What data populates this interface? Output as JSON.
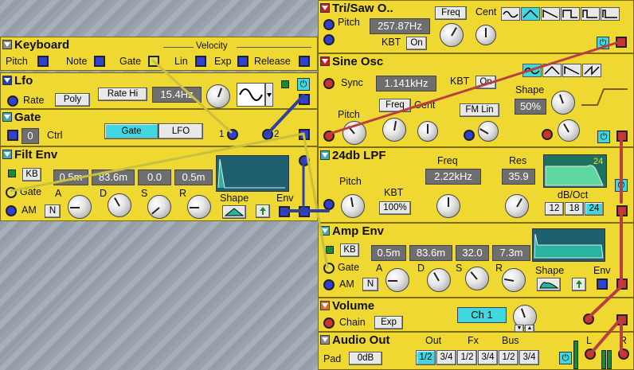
{
  "tri_saw": {
    "title": "Tri/Saw O..",
    "pitch_label": "Pitch",
    "freq_value": "257.87Hz",
    "freq_btn": "Freq",
    "cent_label": "Cent",
    "kbt_label": "KBT",
    "kbt_value": "On"
  },
  "keyboard": {
    "title": "Keyboard",
    "velocity_label": "Velocity",
    "pitch": "Pitch",
    "note": "Note",
    "gate": "Gate",
    "lin": "Lin",
    "exp": "Exp",
    "release": "Release"
  },
  "sine_osc": {
    "title": "Sine Osc",
    "sync_label": "Sync",
    "freq_value": "1.141kHz",
    "kbt_label": "KBT",
    "kbt_value": "On",
    "shape_label": "Shape",
    "shape_value": "50%",
    "pitch_label": "Pitch",
    "freq_btn": "Freq",
    "cent_label": "Cent",
    "fm_btn": "FM Lin"
  },
  "lfo": {
    "title": "Lfo",
    "rate_label": "Rate",
    "poly_btn": "Poly",
    "rate_hi_btn": "Rate Hi",
    "rate_value": "15.4Hz"
  },
  "gate": {
    "title": "Gate",
    "ctrl_value": "0",
    "ctrl_label": "Ctrl",
    "gate_btn": "Gate",
    "lfo_btn": "LFO",
    "port1": "1",
    "port2": "2"
  },
  "filt_env": {
    "title": "Filt Env",
    "kb_btn": "KB",
    "a_value": "0.5m",
    "d_value": "83.6m",
    "s_value": "0.0",
    "r_value": "0.5m",
    "gate_label": "Gate",
    "a": "A",
    "d": "D",
    "s": "S",
    "r": "R",
    "shape_label": "Shape",
    "env_label": "Env",
    "am_label": "AM",
    "n_btn": "N"
  },
  "lpf": {
    "title": "24db LPF",
    "freq_label": "Freq",
    "res_label": "Res",
    "freq_value": "2.22kHz",
    "res_value": "35.9",
    "pitch_label": "Pitch",
    "kbt_label": "KBT",
    "kbt_value": "100%",
    "slope_label": "dB/Oct",
    "slope_options": [
      "12",
      "18",
      "24"
    ],
    "graph_tag": "24"
  },
  "amp_env": {
    "title": "Amp Env",
    "kb_btn": "KB",
    "a_value": "0.5m",
    "d_value": "83.6m",
    "s_value": "32.0",
    "r_value": "7.3m",
    "gate_label": "Gate",
    "a": "A",
    "d": "D",
    "s": "S",
    "r": "R",
    "shape_label": "Shape",
    "env_label": "Env",
    "am_label": "AM",
    "n_btn": "N"
  },
  "volume": {
    "title": "Volume",
    "chain_label": "Chain",
    "exp_btn": "Exp",
    "ch_value": "Ch 1"
  },
  "audio_out": {
    "title": "Audio Out",
    "out_label": "Out",
    "fx_label": "Fx",
    "bus_label": "Bus",
    "pad_label": "Pad",
    "pad_value": "0dB",
    "l_label": "L",
    "r_label": "R",
    "opts": [
      "1/2",
      "3/4",
      "1/2",
      "3/4",
      "1/2",
      "3/4"
    ]
  }
}
